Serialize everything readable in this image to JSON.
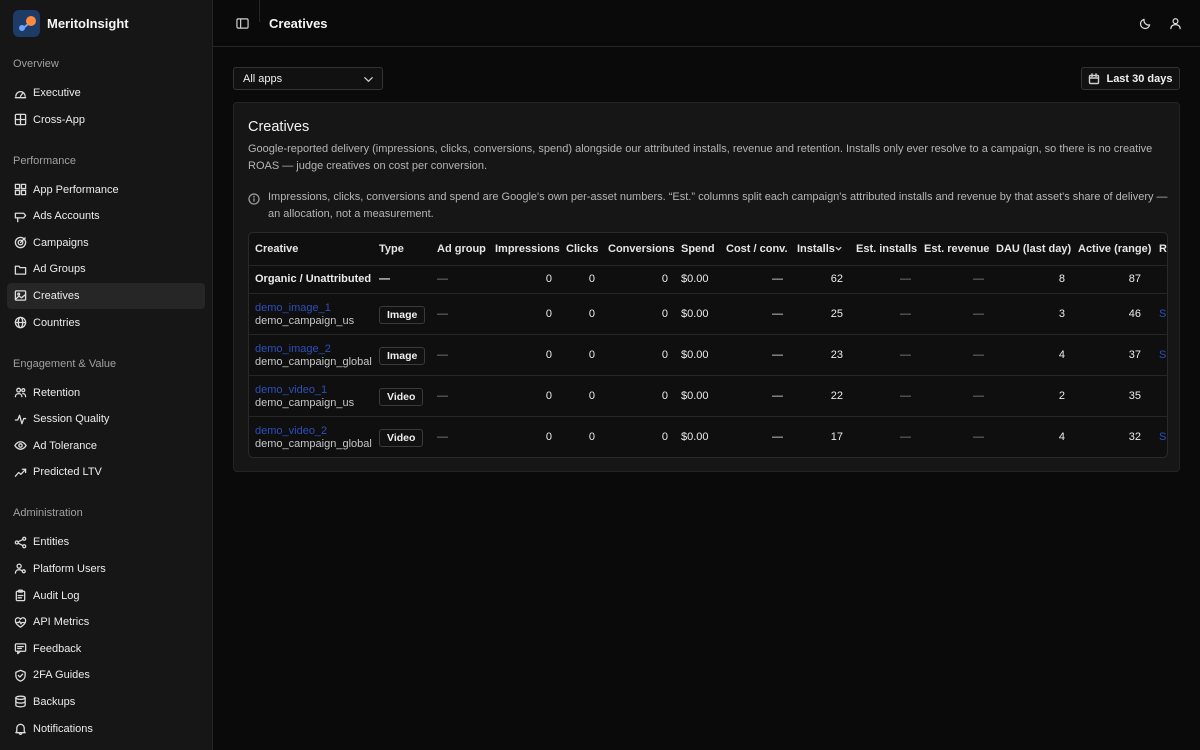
{
  "app": {
    "name": "MeritoInsight"
  },
  "sidebar": {
    "sections": [
      {
        "title": "Overview",
        "items": [
          {
            "label": "Executive",
            "icon": "gauge-icon"
          },
          {
            "label": "Cross-App",
            "icon": "grid-icon"
          }
        ]
      },
      {
        "title": "Performance",
        "items": [
          {
            "label": "App Performance",
            "icon": "dashboard-grid-icon"
          },
          {
            "label": "Ads Accounts",
            "icon": "send-icon"
          },
          {
            "label": "Campaigns",
            "icon": "target-icon"
          },
          {
            "label": "Ad Groups",
            "icon": "folder-icon"
          },
          {
            "label": "Creatives",
            "icon": "image-icon",
            "active": true
          },
          {
            "label": "Countries",
            "icon": "globe-icon"
          }
        ]
      },
      {
        "title": "Engagement & Value",
        "items": [
          {
            "label": "Retention",
            "icon": "users-icon"
          },
          {
            "label": "Session Quality",
            "icon": "activity-icon"
          },
          {
            "label": "Ad Tolerance",
            "icon": "eye-icon"
          },
          {
            "label": "Predicted LTV",
            "icon": "trending-up-icon"
          }
        ]
      },
      {
        "title": "Administration",
        "items": [
          {
            "label": "Entities",
            "icon": "share-nodes-icon"
          },
          {
            "label": "Platform Users",
            "icon": "user-cog-icon"
          },
          {
            "label": "Audit Log",
            "icon": "clipboard-icon"
          },
          {
            "label": "API Metrics",
            "icon": "heart-pulse-icon"
          },
          {
            "label": "Feedback",
            "icon": "message-icon"
          },
          {
            "label": "2FA Guides",
            "icon": "shield-check-icon"
          },
          {
            "label": "Backups",
            "icon": "database-icon"
          },
          {
            "label": "Notifications",
            "icon": "bell-icon"
          }
        ]
      }
    ]
  },
  "header": {
    "title": "Creatives"
  },
  "filters": {
    "app_select": "All apps",
    "date_range": "Last 30 days"
  },
  "card": {
    "title": "Creatives",
    "description": "Google-reported delivery (impressions, clicks, conversions, spend) alongside our attributed installs, revenue and retention. Installs only ever resolve to a campaign, so there is no creative ROAS — judge creatives on cost per conversion.",
    "info": "Impressions, clicks, conversions and spend are Google's own per-asset numbers. “Est.” columns split each campaign's attributed installs and revenue by that asset's share of delivery — an allocation, not a measurement."
  },
  "table": {
    "columns": [
      "Creative",
      "Type",
      "Ad group",
      "Impressions",
      "Clicks",
      "Conversions",
      "Spend",
      "Cost / conv.",
      "Installs",
      "Est. installs",
      "Est. revenue",
      "DAU (last day)",
      "Active (range)",
      "R"
    ],
    "rows": [
      {
        "creative": "Organic / Unattributed",
        "campaign": "",
        "type": "—",
        "ad_group": "—",
        "impressions": "0",
        "clicks": "0",
        "conversions": "0",
        "spend": "$0.00",
        "cost_conv": "—",
        "installs": "62",
        "est_installs": "—",
        "est_revenue": "—",
        "dau": "8",
        "active": "87",
        "extra": ""
      },
      {
        "creative": "demo_image_1",
        "campaign": "demo_campaign_us",
        "type": "Image",
        "ad_group": "—",
        "impressions": "0",
        "clicks": "0",
        "conversions": "0",
        "spend": "$0.00",
        "cost_conv": "—",
        "installs": "25",
        "est_installs": "—",
        "est_revenue": "—",
        "dau": "3",
        "active": "46",
        "extra": "S"
      },
      {
        "creative": "demo_image_2",
        "campaign": "demo_campaign_global",
        "type": "Image",
        "ad_group": "—",
        "impressions": "0",
        "clicks": "0",
        "conversions": "0",
        "spend": "$0.00",
        "cost_conv": "—",
        "installs": "23",
        "est_installs": "—",
        "est_revenue": "—",
        "dau": "4",
        "active": "37",
        "extra": "S"
      },
      {
        "creative": "demo_video_1",
        "campaign": "demo_campaign_us",
        "type": "Video",
        "ad_group": "—",
        "impressions": "0",
        "clicks": "0",
        "conversions": "0",
        "spend": "$0.00",
        "cost_conv": "—",
        "installs": "22",
        "est_installs": "—",
        "est_revenue": "—",
        "dau": "2",
        "active": "35",
        "extra": ""
      },
      {
        "creative": "demo_video_2",
        "campaign": "demo_campaign_global",
        "type": "Video",
        "ad_group": "—",
        "impressions": "0",
        "clicks": "0",
        "conversions": "0",
        "spend": "$0.00",
        "cost_conv": "—",
        "installs": "17",
        "est_installs": "—",
        "est_revenue": "—",
        "dau": "4",
        "active": "32",
        "extra": "S"
      }
    ]
  },
  "colors": {
    "background": "#0a0a0a",
    "sidebar": "#161616",
    "link": "#2d4fb8",
    "accent_orange": "#ff8a3d"
  }
}
